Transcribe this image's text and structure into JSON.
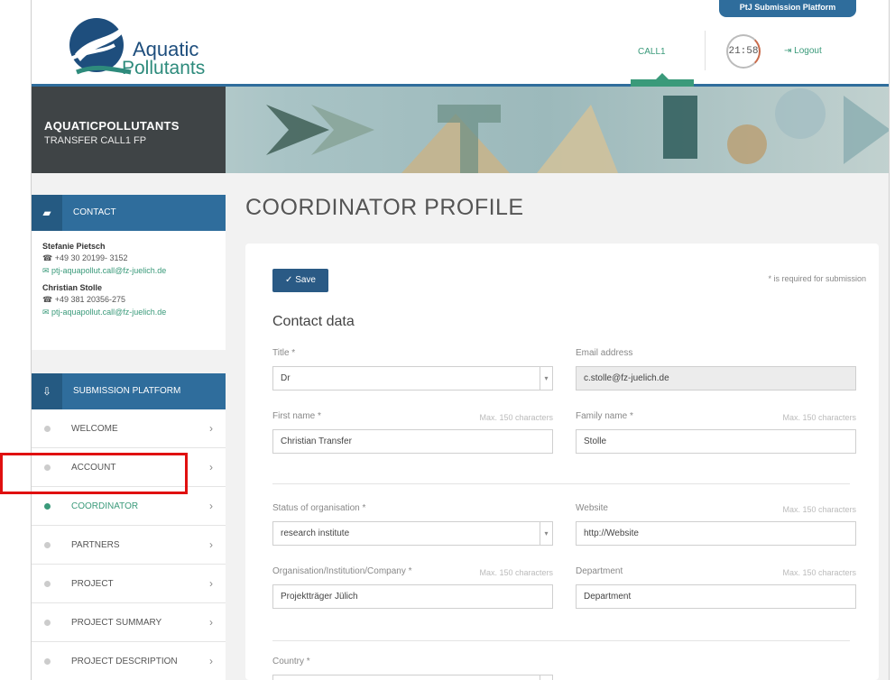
{
  "header": {
    "logo_line1": "Aquatic",
    "logo_line2": "Pollutants",
    "platform_tab": "PtJ Submission Platform",
    "call_link": "CALL1",
    "timer": "21:58",
    "logout": "Logout"
  },
  "banner": {
    "title": "AQUATICPOLLUTANTS",
    "subtitle": "TRANSFER CALL1 FP"
  },
  "contact": {
    "heading": "CONTACT",
    "persons": [
      {
        "name": "Stefanie Pietsch",
        "phone": "+49 30 20199- 3152",
        "email": "ptj-aquapollut.call@fz-juelich.de"
      },
      {
        "name": "Christian Stolle",
        "phone": "+49 381 20356-275",
        "email": "ptj-aquapollut.call@fz-juelich.de"
      }
    ]
  },
  "submission": {
    "heading": "SUBMISSION PLATFORM",
    "items": [
      {
        "label": "WELCOME"
      },
      {
        "label": "ACCOUNT"
      },
      {
        "label": "COORDINATOR"
      },
      {
        "label": "PARTNERS"
      },
      {
        "label": "PROJECT"
      },
      {
        "label": "PROJECT SUMMARY"
      },
      {
        "label": "PROJECT DESCRIPTION"
      }
    ]
  },
  "main": {
    "page_title": "COORDINATOR PROFILE",
    "save_label": "Save",
    "required_note": "* is required for submission",
    "section_title": "Contact data",
    "fields": {
      "title": {
        "label": "Title *",
        "value": "Dr"
      },
      "email": {
        "label": "Email address",
        "value": "c.stolle@fz-juelich.de"
      },
      "first_name": {
        "label": "First name *",
        "max": "Max. 150 characters",
        "value": "Christian Transfer"
      },
      "family_name": {
        "label": "Family name *",
        "max": "Max. 150 characters",
        "value": "Stolle"
      },
      "status": {
        "label": "Status of organisation *",
        "value": "research institute"
      },
      "website": {
        "label": "Website",
        "max": "Max. 150 characters",
        "value": "http://Website"
      },
      "organisation": {
        "label": "Organisation/Institution/Company *",
        "max": "Max. 150 characters",
        "value": "Projektträger Jülich"
      },
      "department": {
        "label": "Department",
        "max": "Max. 150 characters",
        "value": "Department"
      },
      "country": {
        "label": "Country *"
      }
    }
  },
  "colors": {
    "primary_blue": "#2f6d9c",
    "accent_green": "#3a9a7a",
    "annotation_red": "#e01010"
  }
}
